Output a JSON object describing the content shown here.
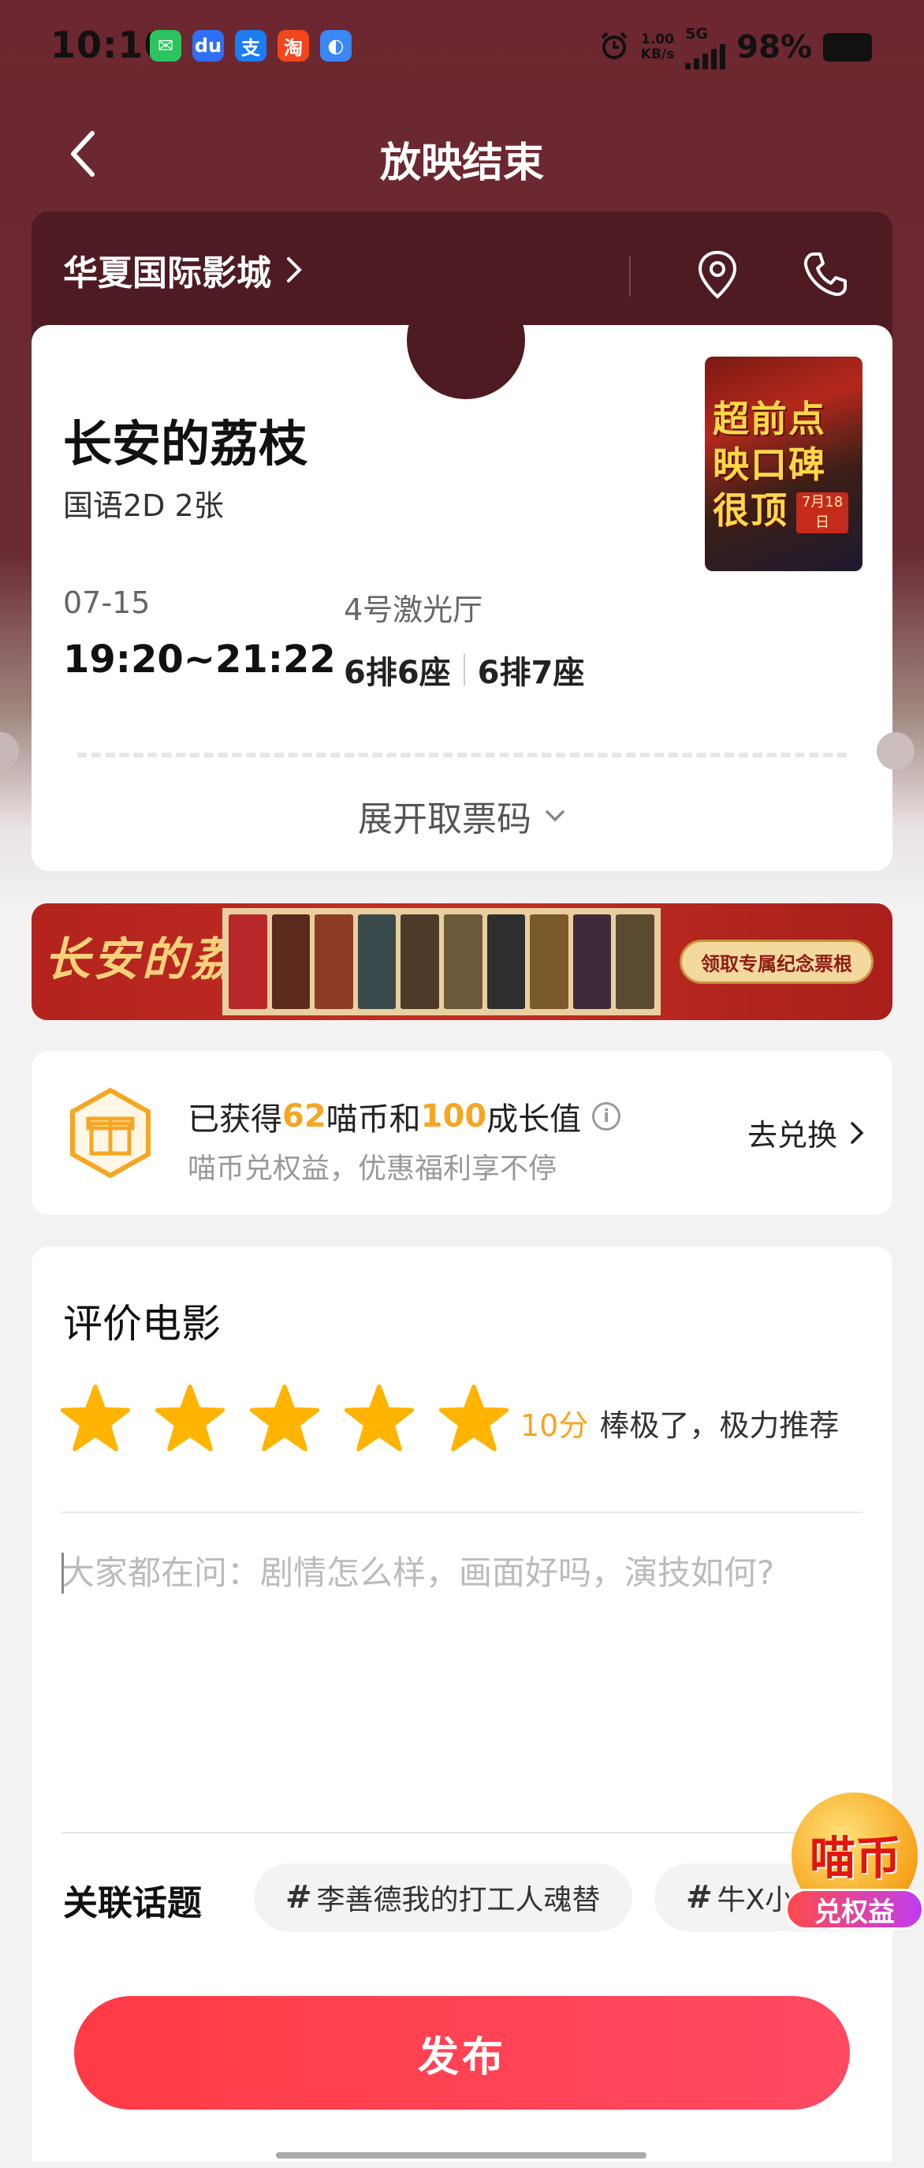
{
  "status_bar": {
    "time": "10:10",
    "apps": [
      {
        "icon": "wechat-icon",
        "glyph": "✉",
        "color": "#2bc45e"
      },
      {
        "icon": "baidu-icon",
        "glyph": "du",
        "color": "#2f6ff5"
      },
      {
        "icon": "alipay-icon",
        "glyph": "支",
        "color": "#1b7cf4"
      },
      {
        "icon": "taobao-icon",
        "glyph": "淘",
        "color": "#f2461d"
      },
      {
        "icon": "browser-icon",
        "glyph": "◐",
        "color": "#3b87f5"
      }
    ],
    "speed_value": "1.00",
    "speed_unit": "KB/s",
    "network": "5G",
    "battery": "98%"
  },
  "header": {
    "title": "放映结束"
  },
  "cinema": {
    "name": "华夏国际影城"
  },
  "ticket": {
    "movie_title": "长安的荔枝",
    "format": "国语2D 2张",
    "poster_text": "超前点映口碑很顶",
    "poster_date": "7月18日",
    "date": "07-15",
    "time": "19:20~21:22",
    "hall": "4号激光厅",
    "seats": [
      "6排6座",
      "6排7座"
    ],
    "expand_label": "展开取票码"
  },
  "banner": {
    "logo_text": "长安的荔枝",
    "button_label": "领取专属纪念票根",
    "ticket_colors": [
      "#b8282a",
      "#5a2a1c",
      "#8c3b24",
      "#3a4a4a",
      "#4d3b2a",
      "#6a5a3a",
      "#2f2f2f",
      "#7a5a2a",
      "#3f2a3a",
      "#5a4a30"
    ]
  },
  "reward": {
    "prefix": "已获得",
    "coins": "62",
    "middle": "喵币和",
    "growth": "100",
    "suffix": "成长值",
    "subtitle": "喵币兑权益，优惠福利享不停",
    "action_label": "去兑换"
  },
  "review": {
    "title": "评价电影",
    "rating_stars": 5,
    "score": "10分",
    "score_desc": "棒极了，极力推荐",
    "placeholder": "大家都在问：剧情怎么样，画面好吗，演技如何?",
    "topics_label": "关联话题",
    "topics": [
      "李善德我的打工人魂替",
      "牛X小..."
    ],
    "publish_label": "发布"
  },
  "float_badge": {
    "title": "喵币",
    "subtitle": "兑权益"
  }
}
